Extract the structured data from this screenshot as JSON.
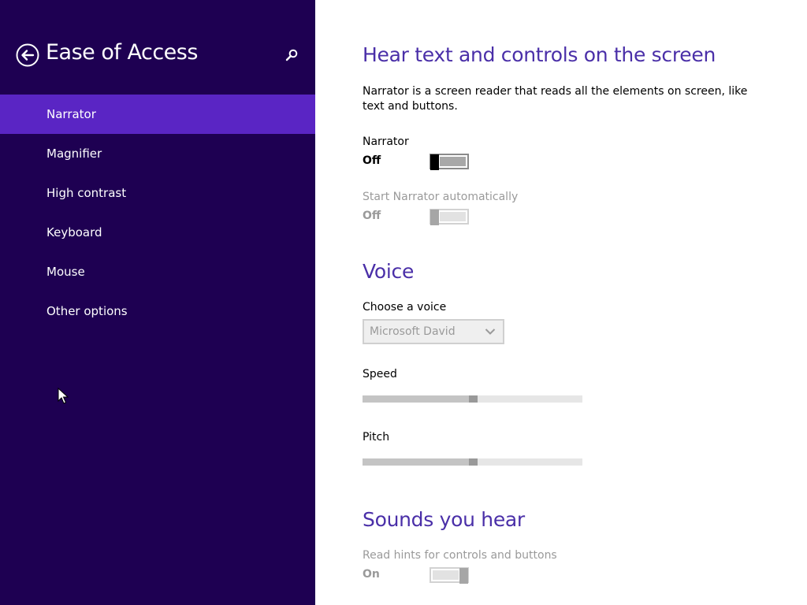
{
  "sidebar": {
    "title": "Ease of Access",
    "items": [
      {
        "label": "Narrator",
        "selected": true
      },
      {
        "label": "Magnifier",
        "selected": false
      },
      {
        "label": "High contrast",
        "selected": false
      },
      {
        "label": "Keyboard",
        "selected": false
      },
      {
        "label": "Mouse",
        "selected": false
      },
      {
        "label": "Other options",
        "selected": false
      }
    ]
  },
  "main": {
    "hear_section": {
      "title": "Hear text and controls on the screen",
      "description": "Narrator is a screen reader that reads all the elements on screen, like text and buttons.",
      "narrator_label": "Narrator",
      "narrator_state": "Off",
      "auto_start_label": "Start Narrator automatically",
      "auto_start_state": "Off"
    },
    "voice_section": {
      "title": "Voice",
      "choose_voice_label": "Choose a voice",
      "voice_value": "Microsoft David",
      "speed_label": "Speed",
      "speed_value": 0.5,
      "pitch_label": "Pitch",
      "pitch_value": 0.5
    },
    "sounds_section": {
      "title": "Sounds you hear",
      "hints_label": "Read hints for controls and buttons",
      "hints_state": "On"
    }
  },
  "colors": {
    "sidebar_bg": "#1e0052",
    "selected_item_bg": "#5a25c4",
    "heading": "#4a2fa8"
  },
  "icons": {
    "back": "back-arrow-circle-icon",
    "search": "search-icon",
    "dropdown": "chevron-down-icon",
    "cursor": "mouse-pointer-icon"
  }
}
